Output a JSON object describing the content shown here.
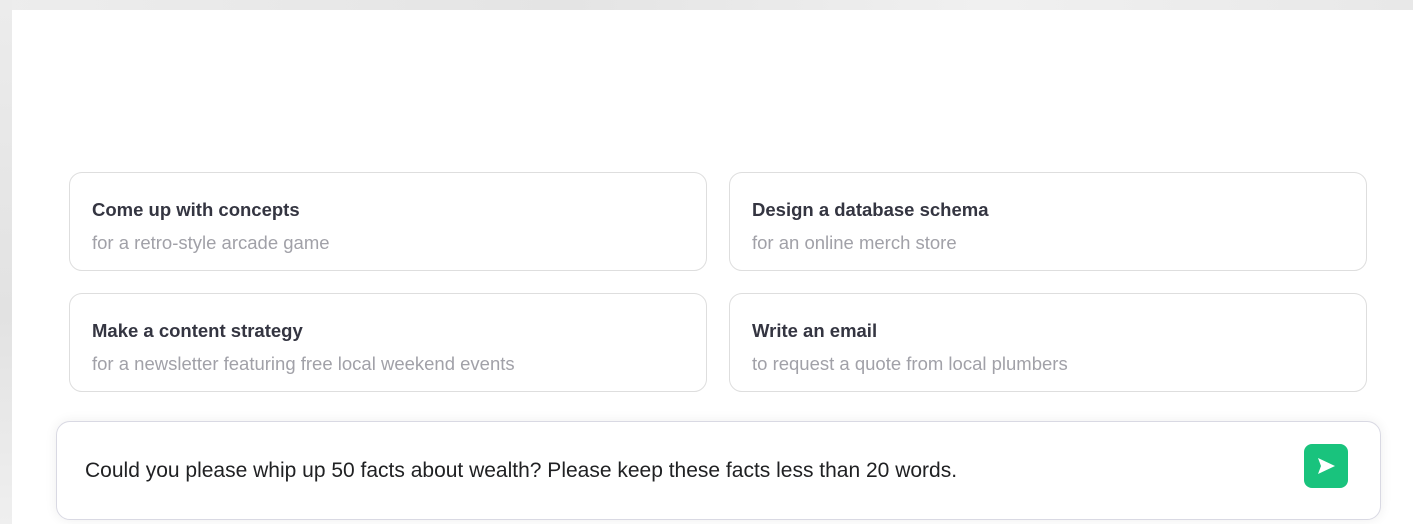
{
  "suggestions": [
    {
      "title": "Come up with concepts",
      "subtitle": "for a retro-style arcade game"
    },
    {
      "title": "Design a database schema",
      "subtitle": "for an online merch store"
    },
    {
      "title": "Make a content strategy",
      "subtitle": "for a newsletter featuring free local weekend events"
    },
    {
      "title": "Write an email",
      "subtitle": "to request a quote from local plumbers"
    }
  ],
  "composer": {
    "text": "Could you please whip up 50 facts about wealth? Please keep these facts less than 20 words.",
    "send_icon": "send-icon"
  },
  "colors": {
    "send_button": "#19c37d",
    "title_text": "#343541",
    "subtitle_text": "#a1a1a8"
  }
}
